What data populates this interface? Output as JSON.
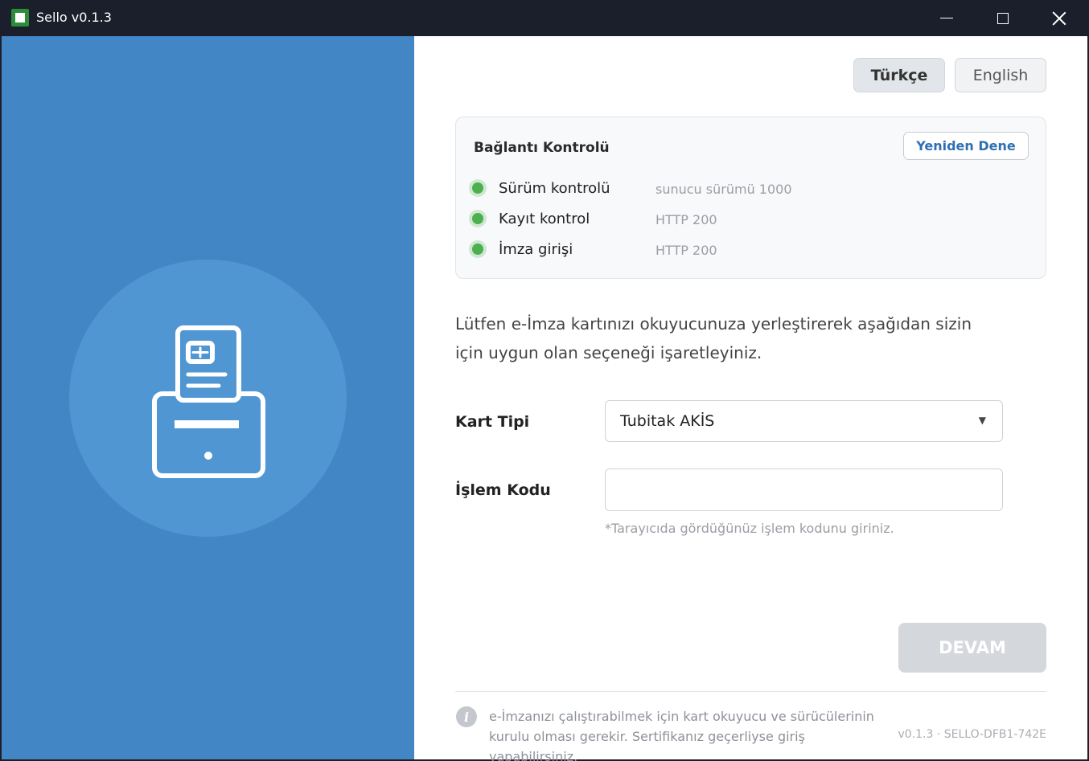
{
  "window": {
    "title": "Sello v0.1.3",
    "controls": [
      "minimize-icon",
      "maximize-icon",
      "close-icon"
    ]
  },
  "colors": {
    "left_panel": "#4286c6",
    "circle": "#5096d3",
    "status_ok": "#4caf50",
    "link_blue": "#2f6fb3",
    "disabled_button": "#d4d7dc"
  },
  "illustration": {
    "icon": "card-reader-icon"
  },
  "language": {
    "turkish": "Türkçe",
    "english": "English",
    "selected": "Türkçe"
  },
  "connection": {
    "title": "Bağlantı Kontrolü",
    "retry_label": "Yeniden Dene",
    "checks": [
      {
        "label": "Sürüm kontrolü",
        "status": "sunucu sürümü 1000",
        "state": "ok"
      },
      {
        "label": "Kayıt kontrol",
        "status": "HTTP 200",
        "state": "ok"
      },
      {
        "label": "İmza girişi",
        "status": "HTTP 200",
        "state": "ok"
      }
    ]
  },
  "instructions": {
    "line1": "Lütfen e-İmza kartınızı okuyucunuza yerleştirerek aşağıdan sizin",
    "line2": "için uygun olan seçeneği işaretleyiniz."
  },
  "form": {
    "card_type_label": "Kart Tipi",
    "card_type_value": "Tubitak AKİS",
    "operation_code_label": "İşlem Kodu",
    "operation_code_value": "",
    "operation_code_hint": "*Tarayıcıda gördüğünüz işlem kodunu giriniz."
  },
  "actions": {
    "continue_label": "DEVAM"
  },
  "footer": {
    "info_line1": "e-İmzanızı çalıştırabilmek için kart okuyucu ve sürücülerinin",
    "info_line2": "kurulu olması gerekir. Sertifikanız geçerliyse giriş yapabilirsiniz.",
    "version": "v0.1.3 · SELLO-DFB1-742E"
  }
}
